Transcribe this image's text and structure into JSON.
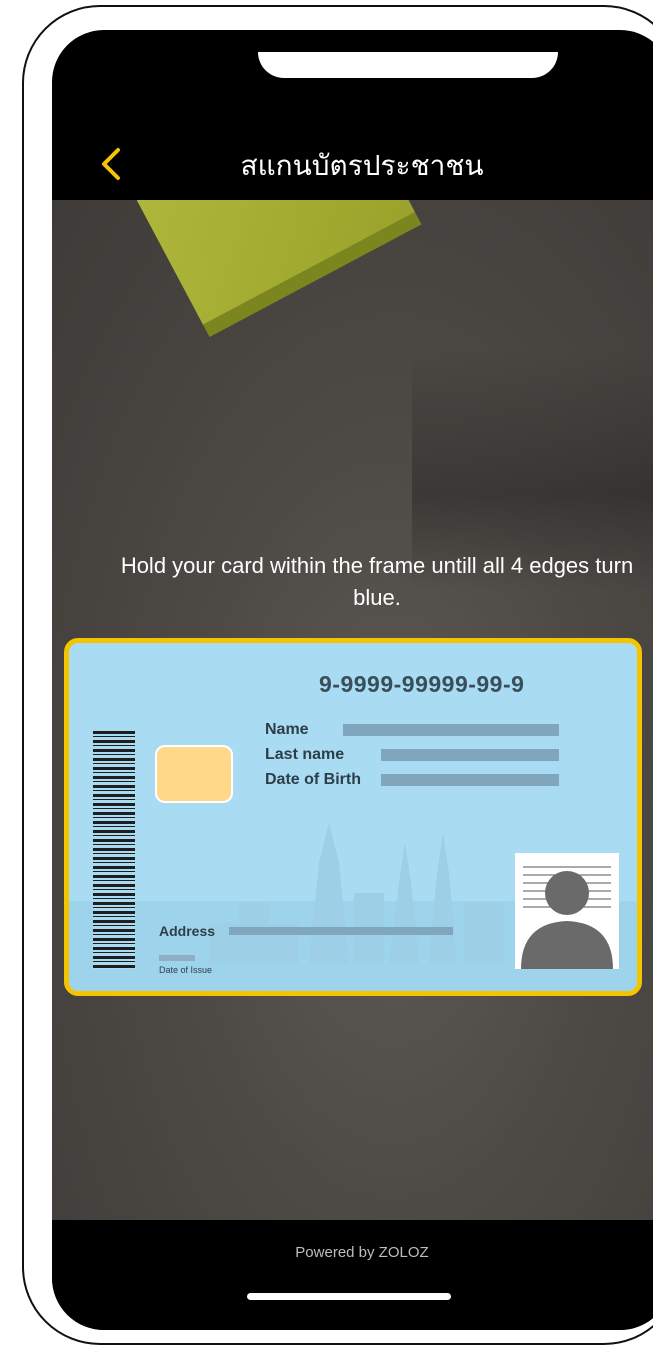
{
  "header": {
    "title": "สแกนบัตรประชาชน"
  },
  "camera": {
    "instruction": "Hold your card within the frame untill all 4 edges turn blue."
  },
  "card": {
    "number": "9-9999-99999-99-9",
    "name_label": "Name",
    "last_name_label": "Last name",
    "dob_label": "Date of Birth",
    "address_label": "Address",
    "date_of_issue_label": "Date of Issue"
  },
  "footer": {
    "powered_by": "Powered by ZOLOZ"
  },
  "colors": {
    "accent": "#f5c400",
    "card_bg": "#a9dcf3"
  },
  "icons": {
    "back": "chevron-left-icon"
  }
}
